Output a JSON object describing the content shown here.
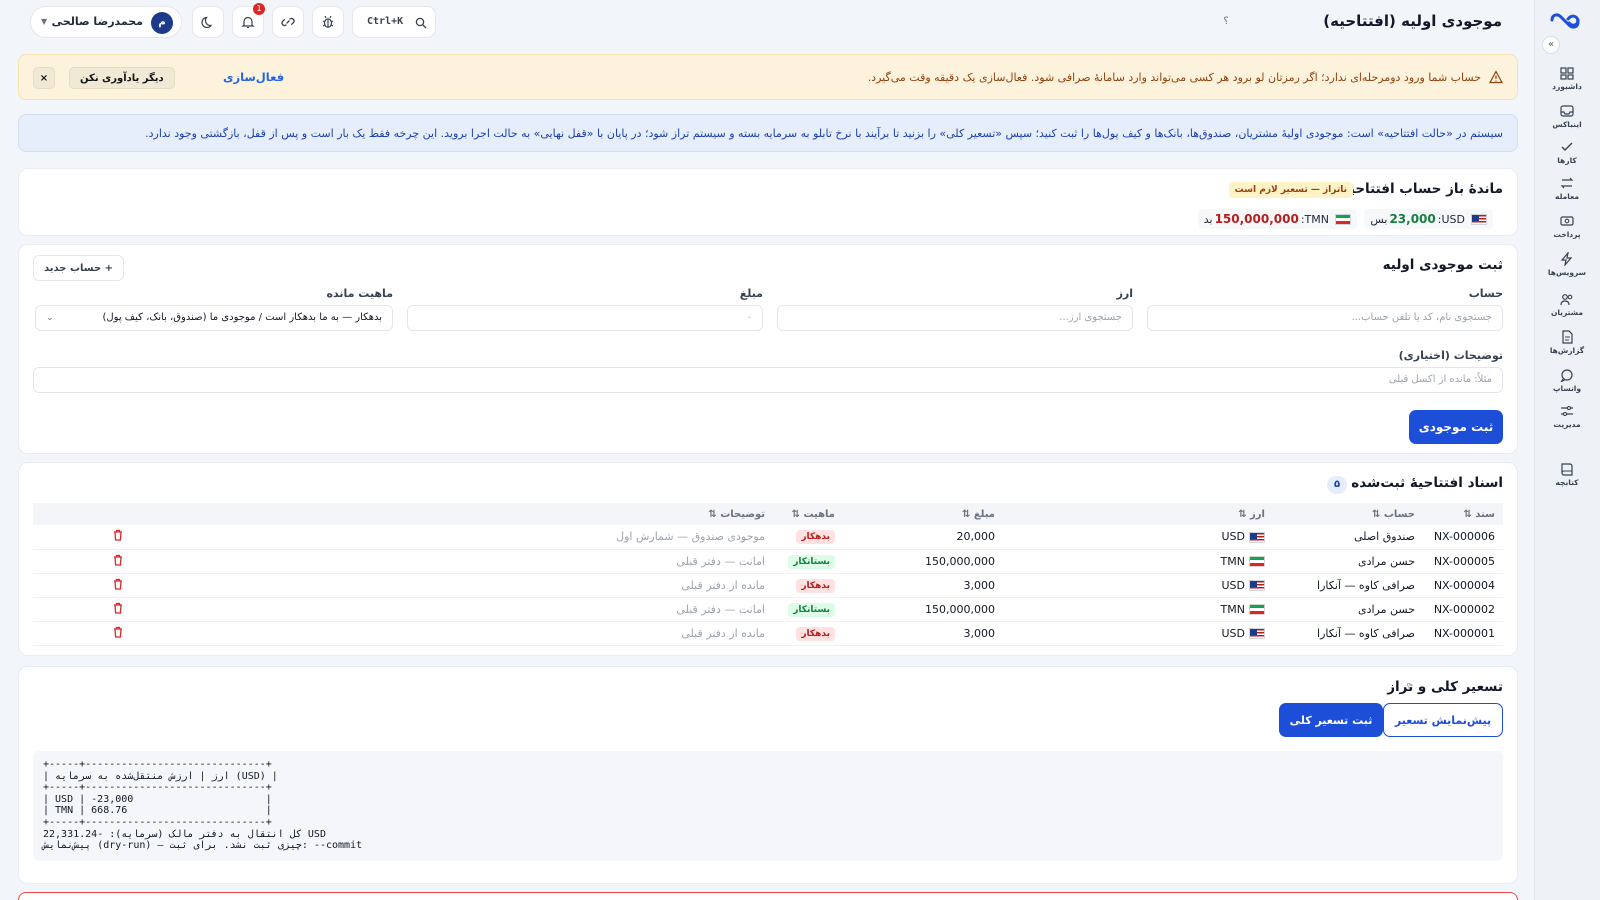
{
  "rail": {
    "items": [
      {
        "label": "داشبورد",
        "icon": "dashboard-icon"
      },
      {
        "label": "اینباکس",
        "icon": "inbox-icon"
      },
      {
        "label": "کارها",
        "icon": "check-icon"
      },
      {
        "label": "معامله",
        "icon": "swap-icon"
      },
      {
        "label": "پرداخت",
        "icon": "payment-icon"
      },
      {
        "label": "سرویس‌ها",
        "icon": "bolt-icon"
      },
      {
        "label": "مشتریان",
        "icon": "users-icon"
      },
      {
        "label": "گزارش‌ها",
        "icon": "report-icon"
      },
      {
        "label": "واتساپ",
        "icon": "whatsapp-icon"
      },
      {
        "label": "مدیریت",
        "icon": "sliders-icon"
      },
      {
        "label": "کتابچه",
        "icon": "book-icon"
      }
    ]
  },
  "header": {
    "title": "موجودی اولیه (افتتاحیه)",
    "help": "؟",
    "user_name": "محمدرضا صالحی",
    "user_initial": "م",
    "search_shortcut": "Ctrl+K",
    "notification_count": "1"
  },
  "alert": {
    "message": "حساب شما ورود دومرحله‌ای ندارد؛ اگر رمزتان لو برود هر کسی می‌تواند وارد سامانهٔ صرافی شود. فعال‌سازی یک دقیقه وقت می‌گیرد.",
    "activate_label": "فعال‌سازی",
    "dismiss_label": "دیگر یادآوری نکن",
    "close_label": "×"
  },
  "info": {
    "text": "سیستم در «حالت افتتاحیه» است: موجودی اولیهٔ مشتریان، صندوق‌ها، بانک‌ها و کیف پول‌ها را ثبت کنید؛ سپس «تسعیر کلی» را بزنید تا برآیند با نرخ تابلو به سرمایه بسته و سیستم تراز شود؛ در پایان با «قفل نهایی» به حالت اجرا بروید. این چرخه فقط یک بار است و پس از قفل، بازگشتی وجود ندارد."
  },
  "balance": {
    "title": "ماندهٔ باز حساب افتتاحیه",
    "badge": "ناتراز — تسعیر لازم است",
    "usd": {
      "code": "USD:",
      "amount": "23,000",
      "suffix": "بس"
    },
    "tmn": {
      "code": "TMN:",
      "amount": "150,000,000",
      "suffix": "بد"
    }
  },
  "form": {
    "title": "ثبت موجودی اولیه",
    "new_account_label": "+ حساب جدید",
    "account_label": "حساب",
    "account_placeholder": "جستجوی نام، کد یا تلفن حساب...",
    "currency_label": "ارز",
    "currency_placeholder": "جستجوی ارز...",
    "amount_label": "مبلغ",
    "amount_placeholder": "۰",
    "nature_label": "ماهیت مانده",
    "nature_value": "بدهکار — به ما بدهکار است / موجودی ما (صندوق، بانک، کیف پول)",
    "notes_label": "توضیحات (اختیاری)",
    "notes_placeholder": "مثلاً: مانده از اکسل قبلی",
    "submit_label": "ثبت موجودی"
  },
  "docs": {
    "title": "اسناد افتتاحیهٔ ثبت‌شده",
    "count": "۵",
    "columns": [
      "سند ⇅",
      "حساب ⇅",
      "ارز ⇅",
      "مبلغ ⇅",
      "ماهیت ⇅",
      "توضیحات ⇅",
      ""
    ],
    "rows": [
      {
        "doc": "NX-000006",
        "account": "صندوق اصلی",
        "currency": "USD",
        "flag": "us",
        "amount": "20,000",
        "nature": "بدهکار",
        "kind": "debt",
        "desc": "موجودی صندوق — شمارش اول"
      },
      {
        "doc": "NX-000005",
        "account": "حسن مرادی",
        "currency": "TMN",
        "flag": "ir",
        "amount": "150,000,000",
        "nature": "بستانکار",
        "kind": "cred",
        "desc": "امانت — دفتر قبلی"
      },
      {
        "doc": "NX-000004",
        "account": "صرافی کاوه — آنکارا",
        "currency": "USD",
        "flag": "us",
        "amount": "3,000",
        "nature": "بدهکار",
        "kind": "debt",
        "desc": "مانده از دفتر قبلی"
      },
      {
        "doc": "NX-000002",
        "account": "حسن مرادی",
        "currency": "TMN",
        "flag": "ir",
        "amount": "150,000,000",
        "nature": "بستانکار",
        "kind": "cred",
        "desc": "امانت — دفتر قبلی"
      },
      {
        "doc": "NX-000001",
        "account": "صرافی کاوه — آنکارا",
        "currency": "USD",
        "flag": "us",
        "amount": "3,000",
        "nature": "بدهکار",
        "kind": "debt",
        "desc": "مانده از دفتر قبلی"
      }
    ]
  },
  "fx": {
    "title": "تسعیر کلی و تراز",
    "help": "؟",
    "commit_label": "ثبت تسعیر کلی",
    "preview_label": "پیش‌نمایش تسعیر",
    "output": "+-----+------------------------------+\n| ارز | ارزش منتقل‌شده به سرمایه (USD) |\n+-----+------------------------------+\n| USD | -23,000                      |\n| TMN | 668.76                       |\n+-----+------------------------------+\nکل انتقال به دفتر مالک (سرمایه): -22,331.24 USD\nپیش‌نمایش (dry-run) — چیزی ثبت نشد. برای ثبت: --commit"
  },
  "colors": {
    "primary": "#1d4ed8",
    "alert_bg": "#fdf3dc",
    "info_bg": "#e6eefc",
    "debit": "#b91c1c",
    "credit": "#15803d"
  }
}
